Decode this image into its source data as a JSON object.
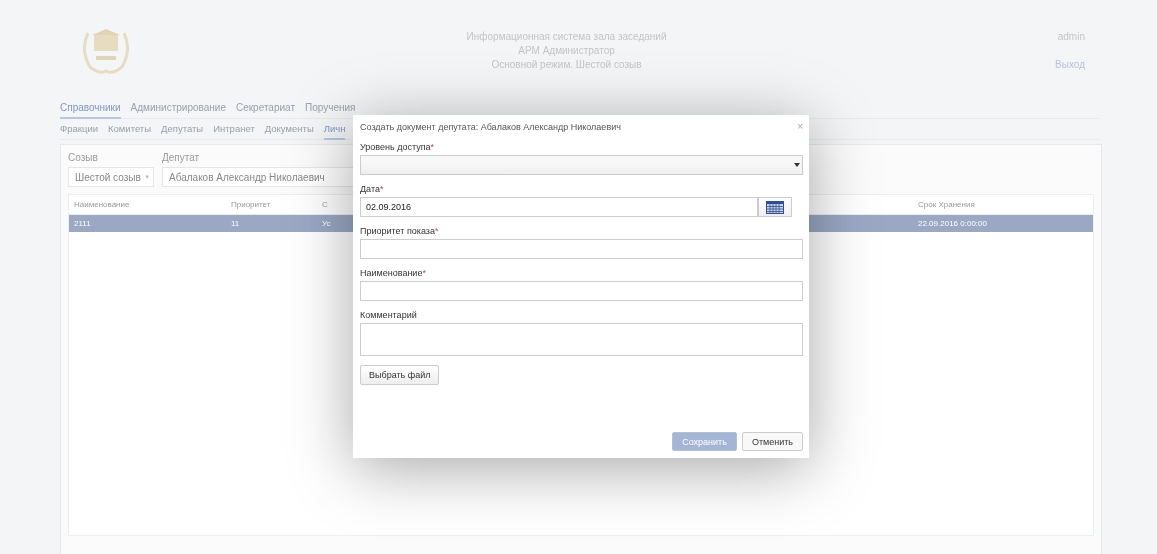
{
  "header": {
    "title_lines": [
      "Информационная система зала заседаний",
      "АРМ Администратор",
      "Основной режим. Шестой созыв"
    ],
    "user": "admin",
    "logout": "Выход"
  },
  "main_tabs": [
    {
      "label": "Справочники",
      "selected": true
    },
    {
      "label": "Администрирование",
      "selected": false
    },
    {
      "label": "Секретариат",
      "selected": false
    },
    {
      "label": "Поручения",
      "selected": false
    }
  ],
  "sub_tabs": [
    {
      "label": "Фракции",
      "selected": false
    },
    {
      "label": "Комитеты",
      "selected": false
    },
    {
      "label": "Депутаты",
      "selected": false
    },
    {
      "label": "Интранет",
      "selected": false
    },
    {
      "label": "Документы",
      "selected": false
    },
    {
      "label": "Личн",
      "selected": true
    }
  ],
  "filters": [
    {
      "label": "Созыв",
      "value": "Шестой созыв"
    },
    {
      "label": "Депутат",
      "value": "Абалаков Александр Николаевич"
    }
  ],
  "table": {
    "columns": [
      "Наименование",
      "Приоритет",
      "С",
      "Срок Хранения"
    ],
    "rows": [
      {
        "selected": true,
        "cells": [
          "2111",
          "11",
          "Ус",
          "22.09.2016 0:00:00"
        ]
      }
    ]
  },
  "dialog": {
    "title": "Создать документ депутата: Абалаков Александр Николаевич",
    "close": "×",
    "fields": [
      {
        "kind": "select",
        "label": "Уровень доступа",
        "required_mark": "*"
      },
      {
        "kind": "date",
        "label": "Дата",
        "required_mark": "*",
        "value": "02.09.2016"
      },
      {
        "kind": "text",
        "label": "Приоритет показа",
        "required_mark": "*"
      },
      {
        "kind": "text",
        "label": "Наименование",
        "required_mark": "*"
      },
      {
        "kind": "textarea",
        "label": "Комментарий"
      }
    ],
    "file_button": "Выбрать файл",
    "buttons": [
      {
        "label": "Сохранить",
        "kind": "primary",
        "disabled": true
      },
      {
        "label": "Отменить",
        "kind": "default",
        "disabled": false
      }
    ]
  }
}
